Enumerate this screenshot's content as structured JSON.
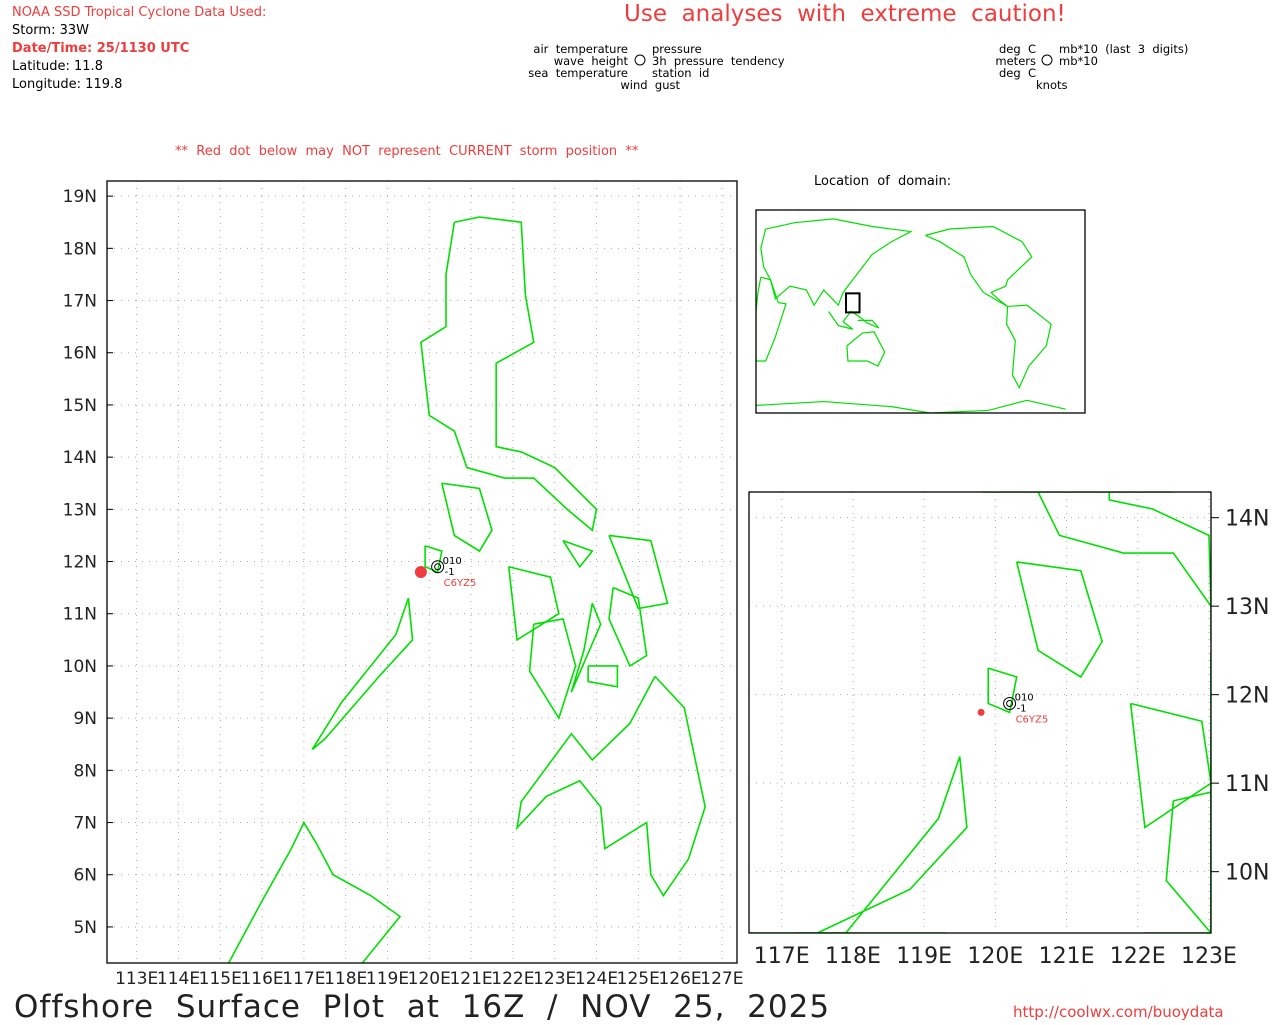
{
  "header": {
    "source": "NOAA SSD Tropical Cyclone Data Used:",
    "storm": "Storm: 33W",
    "datetime": "Date/Time: 25/1130 UTC",
    "latitude": "Latitude: 11.8",
    "longitude": "Longitude: 119.8",
    "caution": "Use  analyses  with  extreme  caution!"
  },
  "legend_left": {
    "tl": "air  temperature",
    "ml": "wave  height",
    "bl": "sea  temperature",
    "bottom": "wind  gust",
    "tr": "pressure",
    "mr": "3h  pressure  tendency",
    "br": "station  id"
  },
  "legend_right": {
    "tl": "deg  C",
    "ml": "meters",
    "bl": "deg  C",
    "bottom": "knots",
    "tr": "mb*10  (last  3  digits)",
    "mr": "mb*10"
  },
  "warning": "**  Red  dot  below  may  NOT  represent  CURRENT  storm  position  **",
  "domain_label": "Location  of  domain:",
  "main_map": {
    "lat_labels": [
      "19N",
      "18N",
      "17N",
      "16N",
      "15N",
      "14N",
      "13N",
      "12N",
      "11N",
      "10N",
      "9N",
      "8N",
      "7N",
      "6N",
      "5N"
    ],
    "lon_labels": [
      "113E",
      "114E",
      "115E",
      "116E",
      "117E",
      "118E",
      "119E",
      "120E",
      "121E",
      "122E",
      "123E",
      "124E",
      "125E",
      "126E",
      "127E"
    ]
  },
  "inset_map": {
    "lat_labels": [
      "14N",
      "13N",
      "12N",
      "11N",
      "10N"
    ],
    "lon_labels": [
      "117E",
      "118E",
      "119E",
      "120E",
      "121E",
      "122E",
      "123E"
    ]
  },
  "station": {
    "id": "C6YZ5",
    "pressure": "010",
    "tendency": "-1",
    "lon": 120.2,
    "lat": 11.9
  },
  "storm_position": {
    "lon": 119.8,
    "lat": 11.8
  },
  "colors": {
    "coast": "#00e000",
    "red": "#f03c3c"
  },
  "footer": {
    "title": "Offshore  Surface  Plot  at  16Z  /  NOV  25,  2025",
    "url": "http://coolwx.com/buoydata"
  }
}
